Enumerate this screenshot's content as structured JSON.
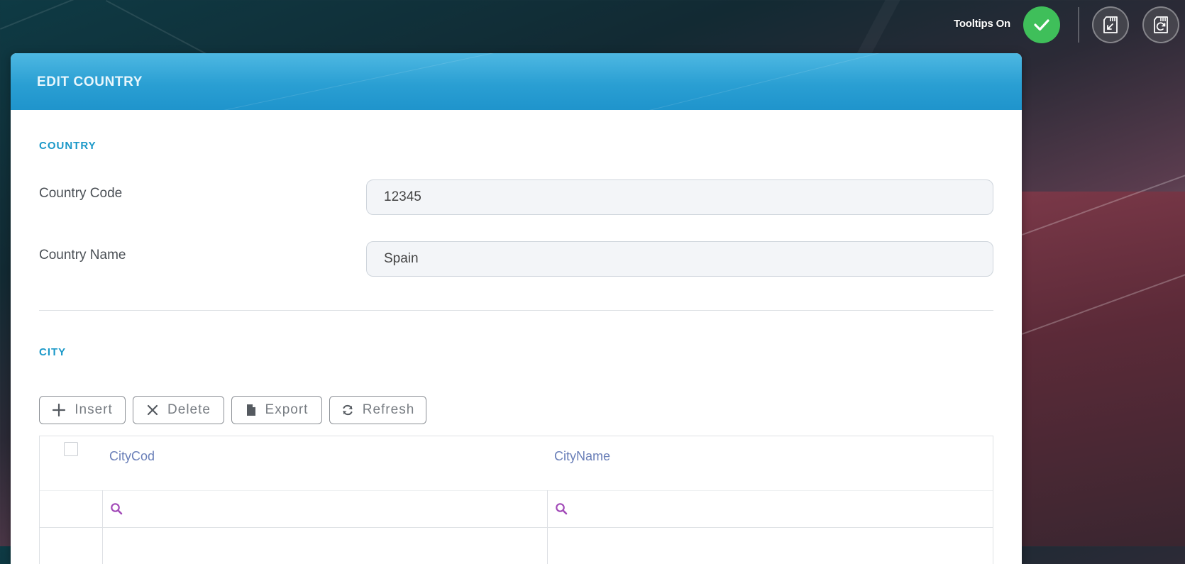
{
  "toolbar": {
    "tooltips_label": "Tooltips On",
    "tooltips_icon": "check-icon",
    "buttons": [
      {
        "name": "save-exit-button",
        "icon": "sd-card-arrow-icon"
      },
      {
        "name": "save-refresh-button",
        "icon": "sd-card-refresh-icon"
      }
    ]
  },
  "card": {
    "title": "EDIT COUNTRY",
    "country_section": {
      "title": "COUNTRY",
      "fields": [
        {
          "label": "Country Code",
          "value": "12345"
        },
        {
          "label": "Country Name",
          "value": "Spain"
        }
      ]
    },
    "city_section": {
      "title": "CITY",
      "actions": [
        {
          "label": "Insert",
          "icon": "plus-icon"
        },
        {
          "label": "Delete",
          "icon": "close-icon"
        },
        {
          "label": "Export",
          "icon": "file-icon"
        },
        {
          "label": "Refresh",
          "icon": "refresh-icon"
        }
      ],
      "grid": {
        "columns": [
          "CityCod",
          "CityName"
        ],
        "filter_icon": "search-icon"
      }
    }
  },
  "colors": {
    "header_blue": "#2a9fd3",
    "section_title": "#1a98c8",
    "toggle_green": "#3fbf5a",
    "column_header": "#6a7fb8",
    "filter_icon": "#a24ab8"
  }
}
